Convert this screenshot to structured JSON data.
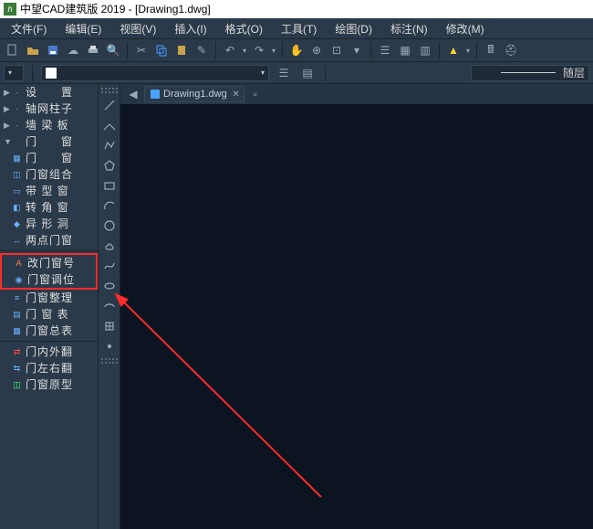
{
  "title": "中望CAD建筑版  2019 - [Drawing1.dwg]",
  "app_icon_glyph": "h",
  "menu": {
    "file": "文件(F)",
    "edit": "编辑(E)",
    "view": "视图(V)",
    "insert": "插入(I)",
    "format": "格式(O)",
    "tools": "工具(T)",
    "draw": "绘图(D)",
    "annotate": "标注(N)",
    "modify": "修改(M)"
  },
  "layer": {
    "bylayer": "随层"
  },
  "doc": {
    "tab": "Drawing1.dwg"
  },
  "side": {
    "items": [
      {
        "label": "设　　置",
        "caret": "▶",
        "icon": "·"
      },
      {
        "label": "轴网柱子",
        "caret": "▶",
        "icon": "·"
      },
      {
        "label": "墙 梁 板",
        "caret": "▶",
        "icon": "·"
      },
      {
        "label": "门　　窗",
        "caret": "▼",
        "icon": ""
      },
      {
        "label": "门　　窗",
        "caret": "",
        "icon": "▦"
      },
      {
        "label": "门窗组合",
        "caret": "",
        "icon": "◫"
      },
      {
        "label": "带 型 窗",
        "caret": "",
        "icon": "▭"
      },
      {
        "label": "转 角 窗",
        "caret": "",
        "icon": "◧"
      },
      {
        "label": "异 形 洞",
        "caret": "",
        "icon": "◆"
      },
      {
        "label": "两点门窗",
        "caret": "",
        "icon": "↔"
      },
      {
        "label": "改门窗号",
        "caret": "",
        "icon": "A"
      },
      {
        "label": "门窗调位",
        "caret": "",
        "icon": "◉"
      },
      {
        "label": "门窗整理",
        "caret": "",
        "icon": "≡"
      },
      {
        "label": "门 窗 表",
        "caret": "",
        "icon": "▤"
      },
      {
        "label": "门窗总表",
        "caret": "",
        "icon": "▦"
      },
      {
        "label": "门内外翻",
        "caret": "",
        "icon": "⇄"
      },
      {
        "label": "门左右翻",
        "caret": "",
        "icon": "⇆"
      },
      {
        "label": "门窗原型",
        "caret": "",
        "icon": "◫"
      }
    ]
  }
}
